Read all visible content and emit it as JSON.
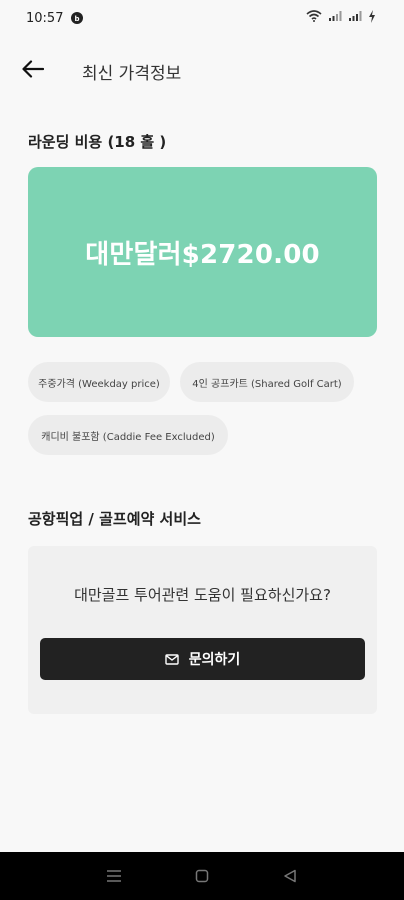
{
  "status_bar": {
    "time": "10:57",
    "icons": [
      "app-badge-icon",
      "wifi-icon",
      "signal-icon",
      "signal-icon",
      "charging-icon"
    ]
  },
  "header": {
    "title": "최신 가격정보",
    "back_icon": "arrow-left-icon"
  },
  "rounding": {
    "section_title": "라운딩 비용 (18 홀 )",
    "price": "대만달러$2720.00",
    "card_color": "#7dd3b3",
    "chips": [
      "주중가격 (Weekday price)",
      "4인 공프카트 (Shared Golf Cart)",
      "캐디비 불포함 (Caddie Fee Excluded)"
    ]
  },
  "service": {
    "section_title": "공항픽업 / 골프예약 서비스",
    "question": "대만골프 투어관련 도움이 필요하신가요?",
    "button_label": "문의하기",
    "button_icon": "mail-icon"
  },
  "nav": {
    "icons": [
      "menu-icon",
      "home-icon",
      "back-icon"
    ]
  }
}
